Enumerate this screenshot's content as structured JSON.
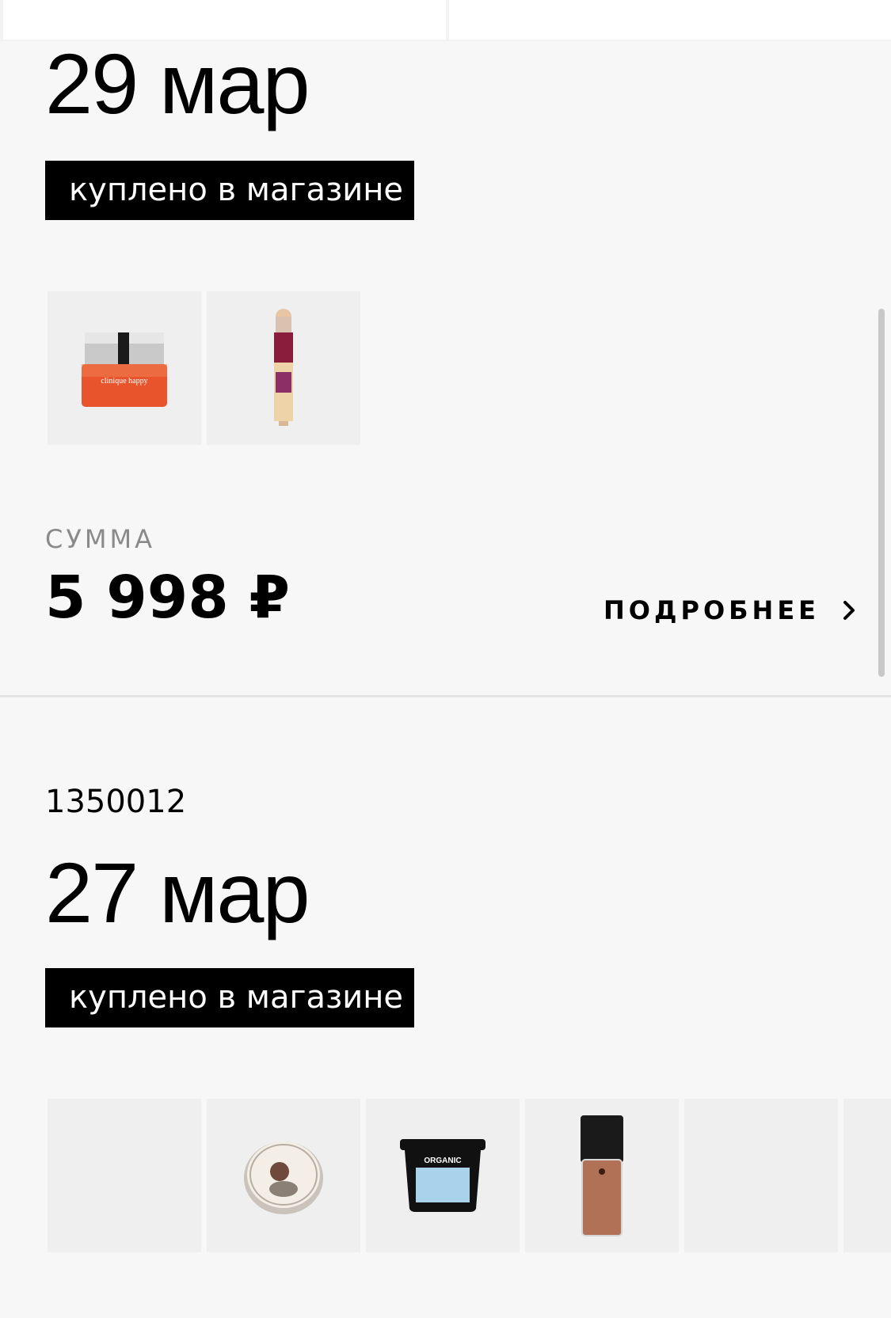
{
  "orders": [
    {
      "date": "29 мар",
      "badge": "куплено в магазине",
      "items": [
        {
          "icon": "cologne-bottle-icon",
          "brand_text": "clinique happy"
        },
        {
          "icon": "concealer-tube-icon"
        }
      ],
      "sum_label": "СУММА",
      "sum_value": "5 998 ₽",
      "more_label": "ПОДРОБНЕЕ"
    },
    {
      "order_number": "1350012",
      "date": "27 мар",
      "badge": "куплено в магазине",
      "items": [
        {
          "icon": "empty-thumb"
        },
        {
          "icon": "round-jar-icon"
        },
        {
          "icon": "mask-jar-icon",
          "brand_text": "ORGANIC"
        },
        {
          "icon": "foundation-bottle-icon"
        },
        {
          "icon": "empty-thumb"
        },
        {
          "icon": "empty-thumb"
        }
      ]
    }
  ],
  "colors": {
    "background": "#f7f7f7",
    "thumb_bg": "#efefef",
    "badge_bg": "#000000",
    "badge_text": "#ffffff",
    "label_grey": "#8a8a8a"
  }
}
